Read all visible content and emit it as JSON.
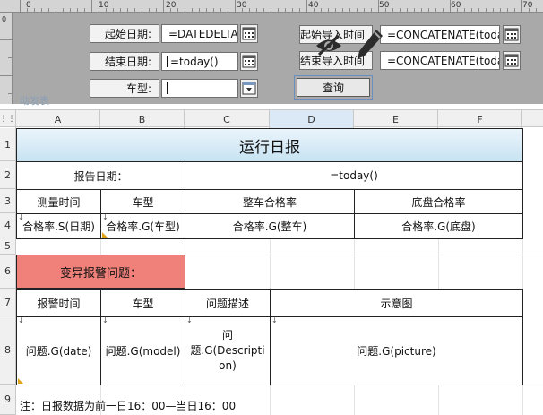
{
  "ruler": {
    "top_numbers": [
      "0",
      "10",
      "20",
      "30",
      "40",
      "50",
      "60",
      "70"
    ],
    "left_number": "0"
  },
  "params": {
    "start_date_label": "起始日期:",
    "start_date_value": "=DATEDELTA(t",
    "end_date_label": "结束日期:",
    "end_date_value": "=today()",
    "model_label": "车型:",
    "model_value": "",
    "start_import_label": "起始导入时间",
    "start_import_value": "=CONCATENATE(toda",
    "end_import_label": "结束导入时间",
    "end_import_value": "=CONCATENATE(toda",
    "query_label": "查询",
    "ghost_label": "动发表"
  },
  "sheet": {
    "columns": [
      "A",
      "B",
      "C",
      "D",
      "E",
      "F"
    ],
    "rows": [
      "1",
      "2",
      "3",
      "4",
      "5",
      "6",
      "7",
      "8",
      "9"
    ],
    "title": "运行日报",
    "report_date_label": "报告日期：",
    "report_date_value": "=today()",
    "headers": [
      "测量时间",
      "车型",
      "整车合格率",
      "底盘合格率"
    ],
    "row4": [
      "合格率.S(日期)",
      "合格率.G(车型)",
      "合格率.G(整车)",
      "合格率.G(底盘)"
    ],
    "alarm_label": "变异报警问题：",
    "alarm_headers": [
      "报警时间",
      "车型",
      "问题描述",
      "示意图"
    ],
    "alarm_row": [
      "问题.G(date)",
      "问题.G(model)",
      "问\n题.G(Descripti\non)",
      "问题.G(picture)"
    ],
    "note": "注：日报数据为前一日16：00—当日16：00"
  }
}
